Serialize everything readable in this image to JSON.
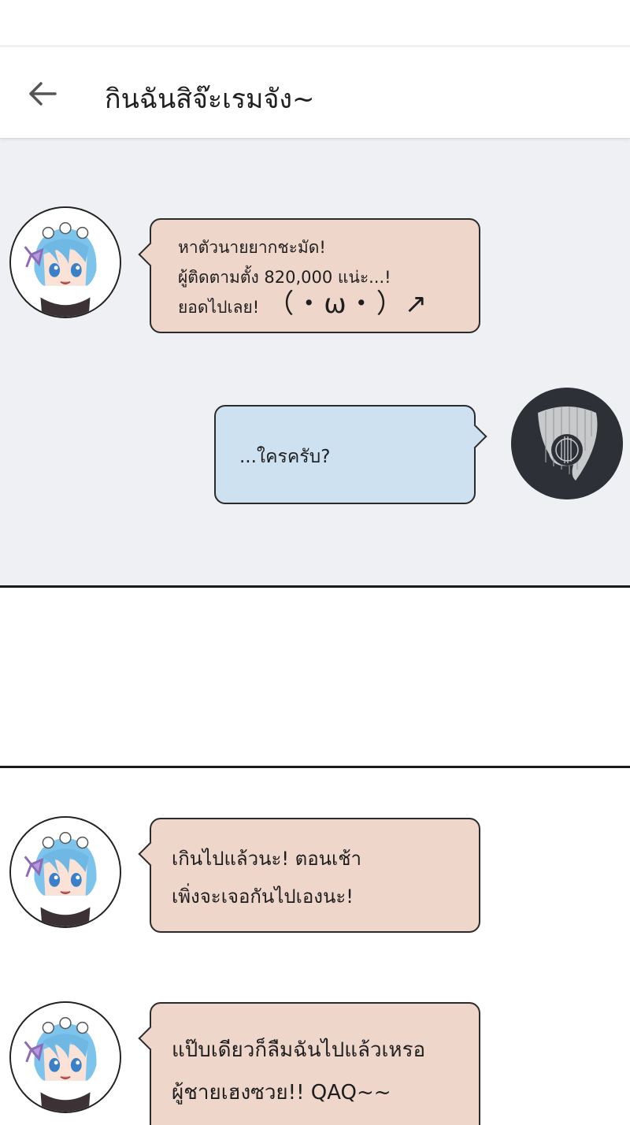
{
  "header": {
    "back_icon": "arrow-left-icon",
    "title": "กินฉันสิจ๊ะเรมจัง~"
  },
  "contacts": {
    "rem": {
      "avatar_icon": "rem-chibi-avatar"
    },
    "me": {
      "avatar_icon": "guitar-pick-avatar"
    }
  },
  "messages_top": [
    {
      "sender": "rem",
      "side": "left",
      "lines": [
        "หาตัวนายยากชะมัด!",
        "ผู้ติดตามตั้ง 820,000 แน่ะ...!",
        "ยอดไปเลย!"
      ],
      "kaomoji": "（・ω・）↗"
    },
    {
      "sender": "me",
      "side": "right",
      "lines": [
        "...ใครครับ?"
      ]
    }
  ],
  "messages_bottom": [
    {
      "sender": "rem",
      "side": "left",
      "lines": [
        "เกินไปแล้วนะ! ตอนเช้า",
        "เพิ่งจะเจอกันไปเองนะ!"
      ]
    },
    {
      "sender": "rem",
      "side": "left",
      "lines": [
        "แป๊บเดียวก็ลืมฉันไปแล้วเหรอ",
        "ผู้ชายเฮงซวย!! QAQ~~"
      ]
    }
  ],
  "colors": {
    "chat_background": "#eef0f4",
    "bubble_left": "#efd6ca",
    "bubble_right": "#cde1f0",
    "avatar_me_bg": "#2d3137"
  }
}
